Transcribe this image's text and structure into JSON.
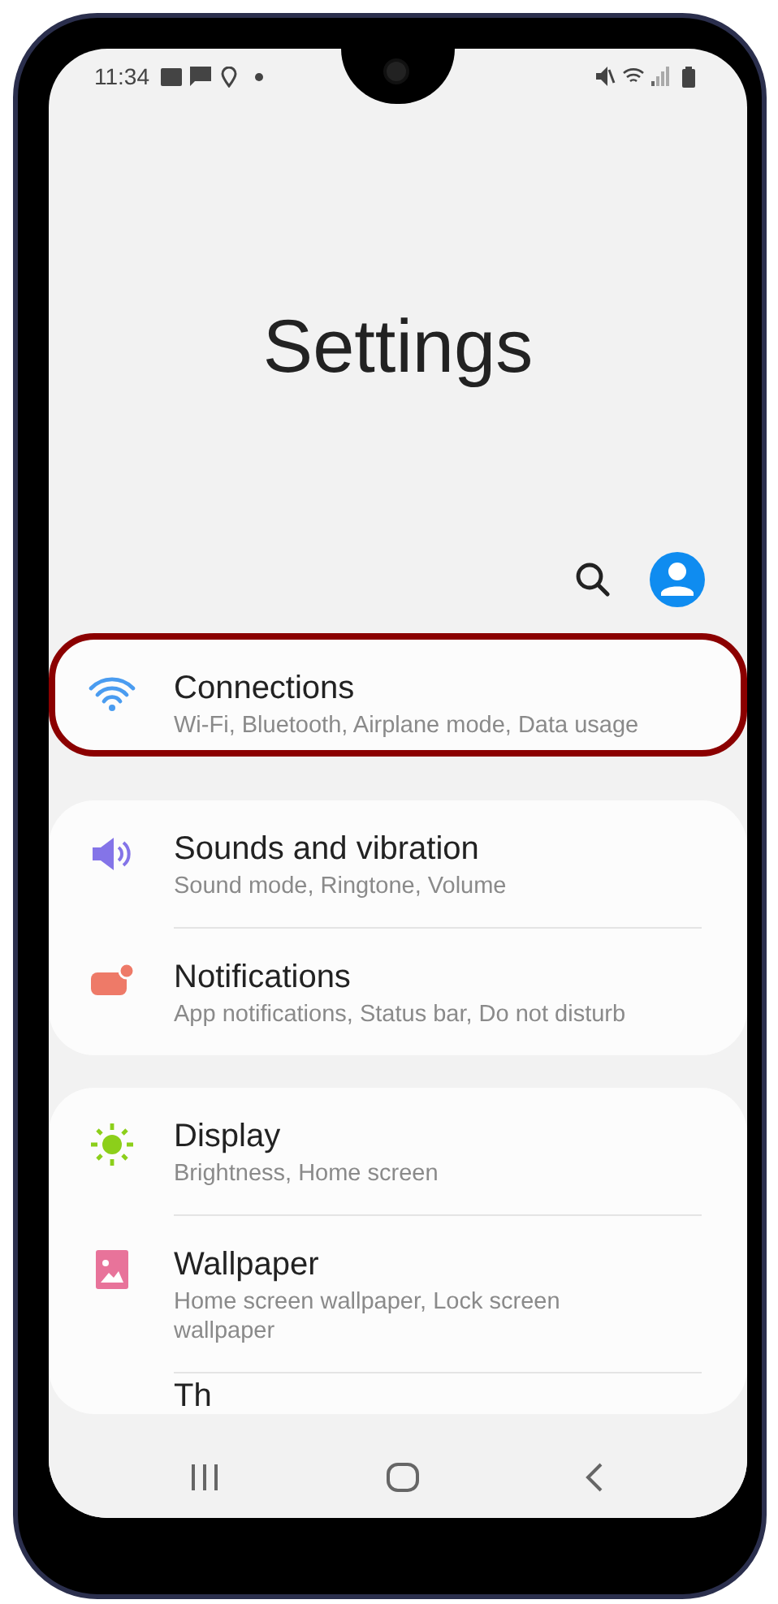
{
  "status_bar": {
    "time": "11:34"
  },
  "title": "Settings",
  "groups": [
    {
      "items": [
        {
          "title": "Connections",
          "subtitle": "Wi-Fi, Bluetooth, Airplane mode, Data usage",
          "color": "#4a9cf0",
          "highlighted": true
        }
      ]
    },
    {
      "items": [
        {
          "title": "Sounds and vibration",
          "subtitle": "Sound mode, Ringtone, Volume",
          "color": "#8474e8",
          "highlighted": false
        },
        {
          "title": "Notifications",
          "subtitle": "App notifications, Status bar, Do not disturb",
          "color": "#ee7a68",
          "highlighted": false
        }
      ]
    },
    {
      "items": [
        {
          "title": "Display",
          "subtitle": "Brightness, Home screen",
          "color": "#8ccf1a",
          "highlighted": false
        },
        {
          "title": "Wallpaper",
          "subtitle": "Home screen wallpaper, Lock screen wallpaper",
          "color": "#e8739a",
          "highlighted": false
        },
        {
          "title": "Th",
          "highlighted": false
        }
      ]
    }
  ]
}
